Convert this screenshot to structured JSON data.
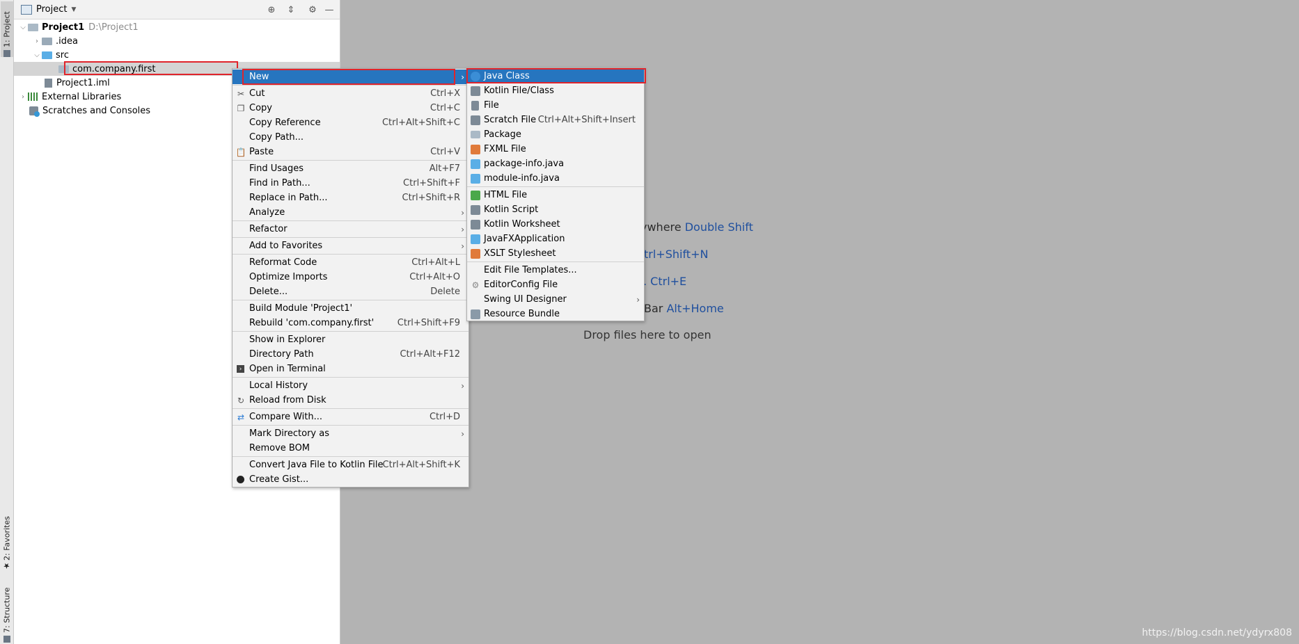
{
  "left_strip": {
    "project_tab": "1: Project",
    "favorites_tab": "2: Favorites",
    "structure_tab": "7: Structure"
  },
  "project_panel": {
    "title": "Project",
    "tree": {
      "root_name": "Project1",
      "root_path": "D:\\Project1",
      "idea": ".idea",
      "src": "src",
      "package": "com.company.first",
      "iml": "Project1.iml",
      "external_libraries": "External Libraries",
      "scratches": "Scratches and Consoles"
    }
  },
  "editor_hints": {
    "search_text": "ywhere",
    "search_key": "Double Shift",
    "goto_file_key": "trl+Shift+N",
    "recent_key": ". Ctrl+E",
    "navbar_text": "Bar",
    "navbar_key": "Alt+Home",
    "drop": "Drop files here to open"
  },
  "context_menu": {
    "items": [
      {
        "label": "New",
        "shortcut": ""
      },
      {
        "label": "Cut",
        "shortcut": "Ctrl+X"
      },
      {
        "label": "Copy",
        "shortcut": "Ctrl+C"
      },
      {
        "label": "Copy Reference",
        "shortcut": "Ctrl+Alt+Shift+C"
      },
      {
        "label": "Copy Path...",
        "shortcut": ""
      },
      {
        "label": "Paste",
        "shortcut": "Ctrl+V"
      },
      {
        "label": "Find Usages",
        "shortcut": "Alt+F7"
      },
      {
        "label": "Find in Path...",
        "shortcut": "Ctrl+Shift+F"
      },
      {
        "label": "Replace in Path...",
        "shortcut": "Ctrl+Shift+R"
      },
      {
        "label": "Analyze",
        "shortcut": ""
      },
      {
        "label": "Refactor",
        "shortcut": ""
      },
      {
        "label": "Add to Favorites",
        "shortcut": ""
      },
      {
        "label": "Reformat Code",
        "shortcut": "Ctrl+Alt+L"
      },
      {
        "label": "Optimize Imports",
        "shortcut": "Ctrl+Alt+O"
      },
      {
        "label": "Delete...",
        "shortcut": "Delete"
      },
      {
        "label": "Build Module 'Project1'",
        "shortcut": ""
      },
      {
        "label": "Rebuild 'com.company.first'",
        "shortcut": "Ctrl+Shift+F9"
      },
      {
        "label": "Show in Explorer",
        "shortcut": ""
      },
      {
        "label": "Directory Path",
        "shortcut": "Ctrl+Alt+F12"
      },
      {
        "label": "Open in Terminal",
        "shortcut": ""
      },
      {
        "label": "Local History",
        "shortcut": ""
      },
      {
        "label": "Reload from Disk",
        "shortcut": ""
      },
      {
        "label": "Compare With...",
        "shortcut": "Ctrl+D"
      },
      {
        "label": "Mark Directory as",
        "shortcut": ""
      },
      {
        "label": "Remove BOM",
        "shortcut": ""
      },
      {
        "label": "Convert Java File to Kotlin File",
        "shortcut": "Ctrl+Alt+Shift+K"
      },
      {
        "label": "Create Gist...",
        "shortcut": ""
      }
    ]
  },
  "new_submenu": {
    "items": [
      {
        "label": "Java Class",
        "shortcut": ""
      },
      {
        "label": "Kotlin File/Class",
        "shortcut": ""
      },
      {
        "label": "File",
        "shortcut": ""
      },
      {
        "label": "Scratch File",
        "shortcut": "Ctrl+Alt+Shift+Insert"
      },
      {
        "label": "Package",
        "shortcut": ""
      },
      {
        "label": "FXML File",
        "shortcut": ""
      },
      {
        "label": "package-info.java",
        "shortcut": ""
      },
      {
        "label": "module-info.java",
        "shortcut": ""
      },
      {
        "label": "HTML File",
        "shortcut": ""
      },
      {
        "label": "Kotlin Script",
        "shortcut": ""
      },
      {
        "label": "Kotlin Worksheet",
        "shortcut": ""
      },
      {
        "label": "JavaFXApplication",
        "shortcut": ""
      },
      {
        "label": "XSLT Stylesheet",
        "shortcut": ""
      },
      {
        "label": "Edit File Templates...",
        "shortcut": ""
      },
      {
        "label": "EditorConfig File",
        "shortcut": ""
      },
      {
        "label": "Swing UI Designer",
        "shortcut": ""
      },
      {
        "label": "Resource Bundle",
        "shortcut": ""
      }
    ]
  },
  "watermark": "https://blog.csdn.net/ydyrx808",
  "colors": {
    "selection": "#2675bf",
    "highlight_border": "#e0242b",
    "editor_bg": "#b3b3b3",
    "hint_key": "#1f4f9e"
  }
}
